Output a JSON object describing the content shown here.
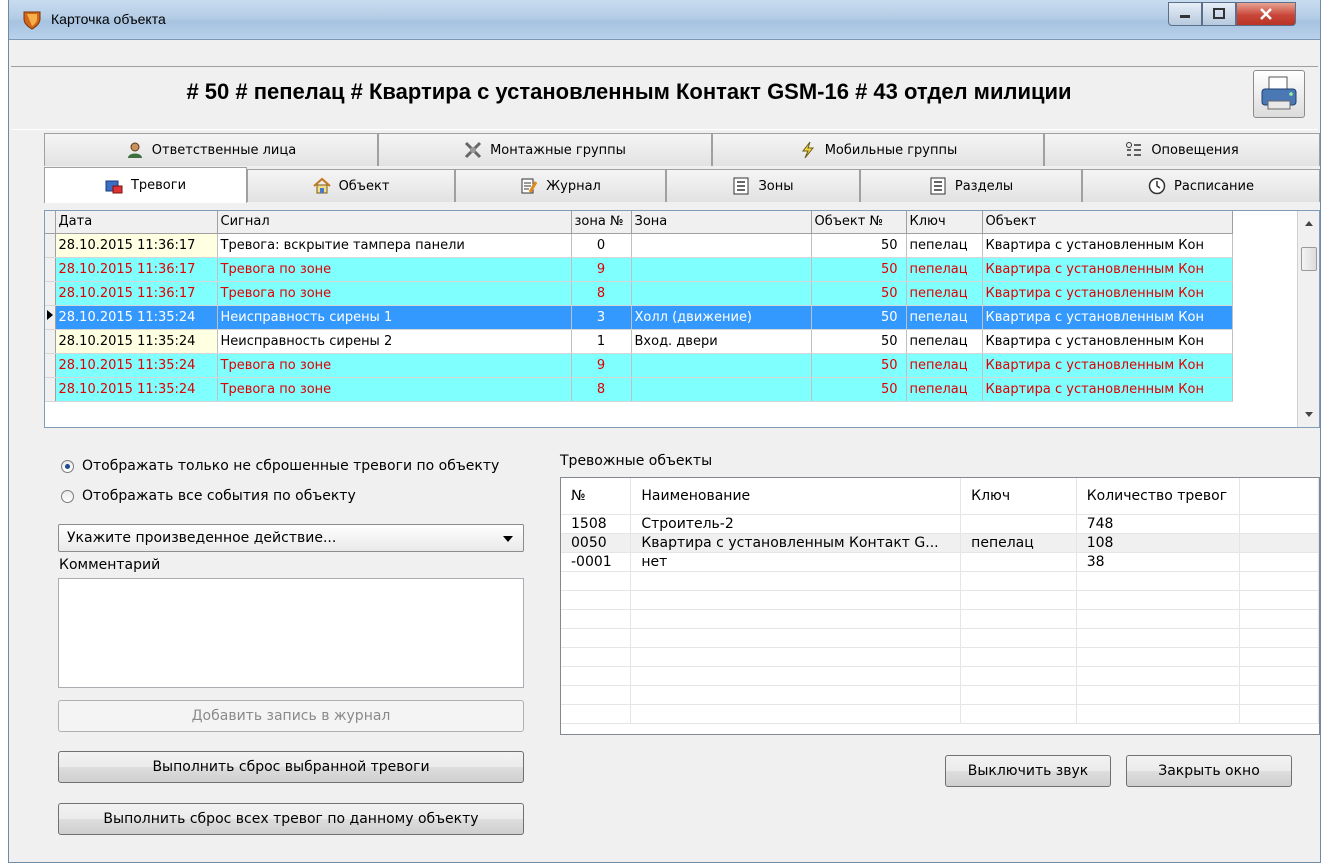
{
  "window": {
    "title": "Карточка объекта"
  },
  "header": {
    "title": "# 50 # пепелац # Квартира с установленным Контакт GSM-16 # 43 отдел милиции"
  },
  "tabs_top": [
    {
      "label": "Ответственные лица",
      "icon": "person-icon"
    },
    {
      "label": "Монтажные группы",
      "icon": "tools-icon"
    },
    {
      "label": "Мобильные группы",
      "icon": "lightning-icon"
    },
    {
      "label": "Оповещения",
      "icon": "list-icon"
    }
  ],
  "tabs_bottom": [
    {
      "label": "Тревоги",
      "icon": "alarm-icon"
    },
    {
      "label": "Объект",
      "icon": "house-icon"
    },
    {
      "label": "Журнал",
      "icon": "journal-icon"
    },
    {
      "label": "Зоны",
      "icon": "zones-icon"
    },
    {
      "label": "Разделы",
      "icon": "sections-icon"
    },
    {
      "label": "Расписание",
      "icon": "clock-icon"
    }
  ],
  "events_grid": {
    "columns": [
      "Дата",
      "Сигнал",
      "зона №",
      "Зона",
      "Объект №",
      "Ключ",
      "Объект"
    ],
    "rows": [
      {
        "date": "28.10.2015 11:36:17",
        "signal": "Тревога: вскрытие тампера панели",
        "zone_no": "0",
        "zone": "",
        "obj_no": "50",
        "key": "пепелац",
        "object": "Квартира с установленным Кон"
      },
      {
        "date": "28.10.2015 11:36:17",
        "signal": "Тревога по зоне",
        "zone_no": "9",
        "zone": "",
        "obj_no": "50",
        "key": "пепелац",
        "object": "Квартира с установленным Кон"
      },
      {
        "date": "28.10.2015 11:36:17",
        "signal": "Тревога по зоне",
        "zone_no": "8",
        "zone": "",
        "obj_no": "50",
        "key": "пепелац",
        "object": "Квартира с установленным Кон"
      },
      {
        "date": "28.10.2015 11:35:24",
        "signal": "Неисправность сирены 1",
        "zone_no": "3",
        "zone": "Холл (движение)",
        "obj_no": "50",
        "key": "пепелац",
        "object": "Квартира с установленным Кон"
      },
      {
        "date": "28.10.2015 11:35:24",
        "signal": "Неисправность сирены 2",
        "zone_no": "1",
        "zone": "Вход. двери",
        "obj_no": "50",
        "key": "пепелац",
        "object": "Квартира с установленным Кон"
      },
      {
        "date": "28.10.2015 11:35:24",
        "signal": "Тревога по зоне",
        "zone_no": "9",
        "zone": "",
        "obj_no": "50",
        "key": "пепелац",
        "object": "Квартира с установленным Кон"
      },
      {
        "date": "28.10.2015 11:35:24",
        "signal": "Тревога по зоне",
        "zone_no": "8",
        "zone": "",
        "obj_no": "50",
        "key": "пепелац",
        "object": "Квартира с установленным Кон"
      }
    ]
  },
  "filters": {
    "radio_unreset": "Отображать только не сброшенные тревоги по объекту",
    "radio_all": "Отображать все события по объекту"
  },
  "action_combo": {
    "value": "Укажите произведенное действие..."
  },
  "comment_label": "Комментарий",
  "buttons": {
    "add_journal": "Добавить запись в журнал",
    "reset_selected": "Выполнить сброс выбранной тревоги",
    "reset_all": "Выполнить сброс всех тревог по данному объекту",
    "mute": "Выключить звук",
    "close": "Закрыть окно"
  },
  "alarm_objects": {
    "title": "Тревожные объекты",
    "columns": [
      "№",
      "Наименование",
      "Ключ",
      "Количество тревог"
    ],
    "rows": [
      {
        "no": "1508",
        "name": "Строитель-2",
        "key": "",
        "count": "748"
      },
      {
        "no": "0050",
        "name": "Квартира с установленным Контакт G...",
        "key": "пепелац",
        "count": "108"
      },
      {
        "no": "-0001",
        "name": "нет",
        "key": "",
        "count": "38"
      }
    ]
  },
  "colors": {
    "alarm_row_bg": "#80ffff",
    "alarm_row_text": "#e00000",
    "selected_row_bg": "#3399ff",
    "date_cell_bg": "#ffffe1"
  }
}
